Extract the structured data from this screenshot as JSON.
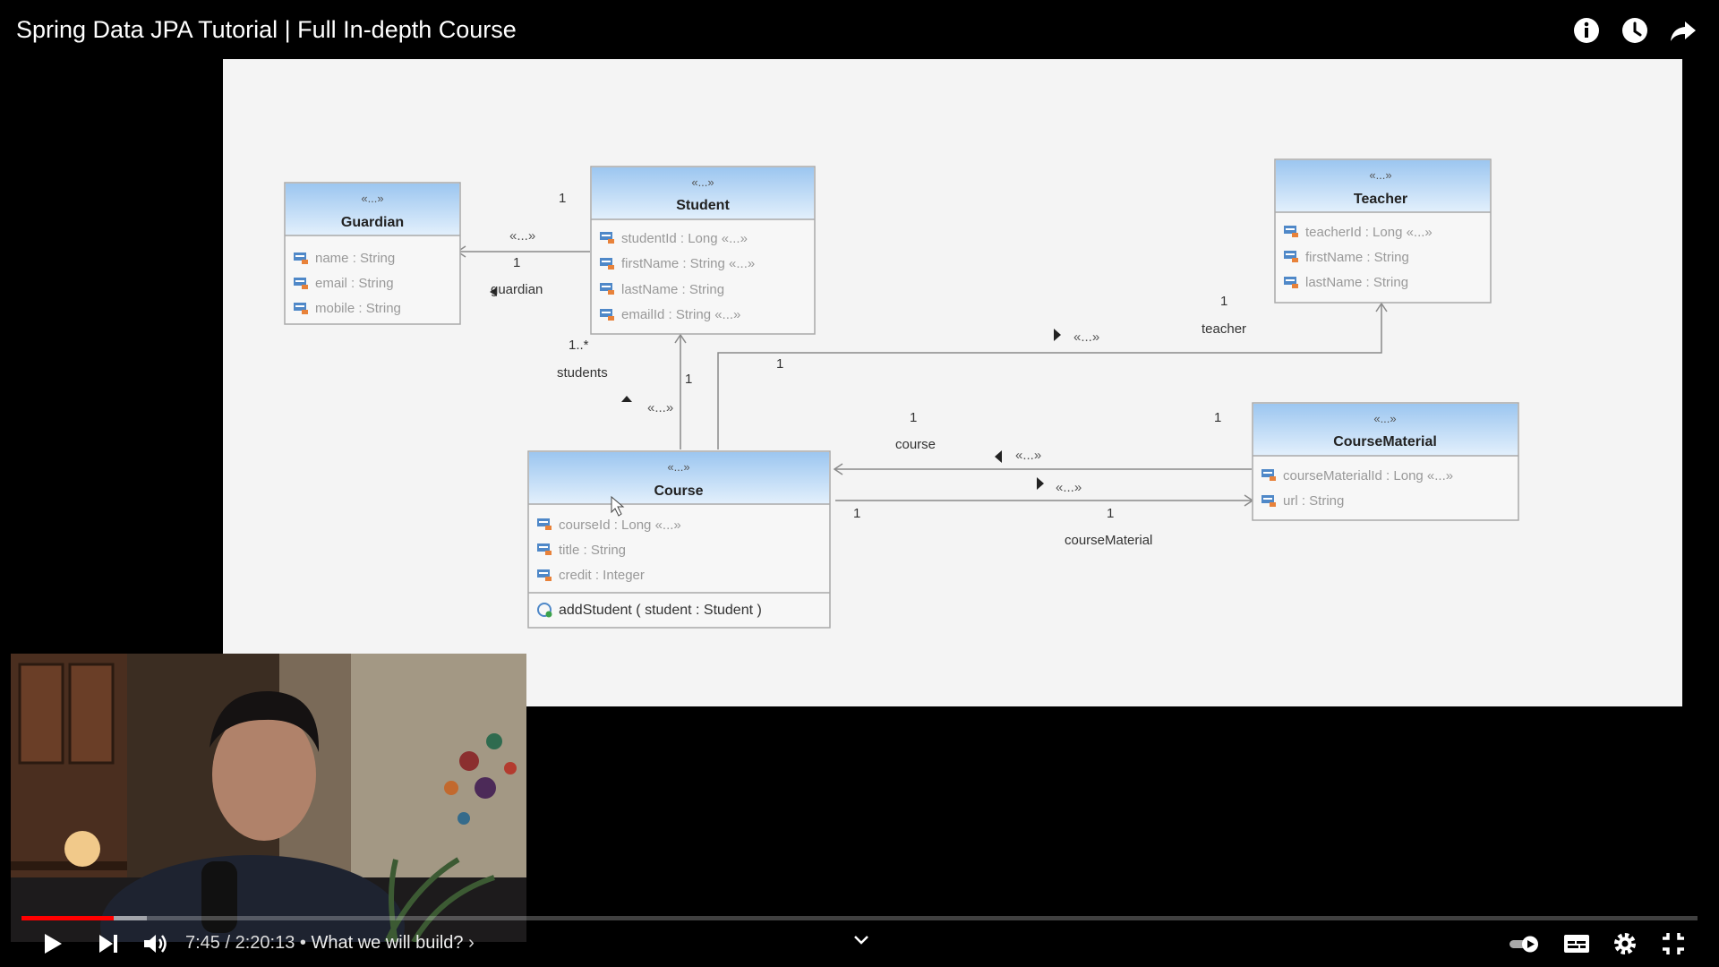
{
  "video": {
    "title": "Spring Data JPA Tutorial | Full In-depth Course",
    "current_time": "7:45",
    "duration": "2:20:13",
    "chapter": "What we will build?",
    "progress_fraction": 0.055,
    "accent_color": "#ff0000"
  },
  "top_icons": [
    "info-icon",
    "watch-later-icon",
    "share-icon"
  ],
  "controls": {
    "left": [
      "play-icon",
      "next-icon",
      "volume-icon"
    ],
    "right": [
      "autoplay-toggle-icon",
      "subtitles-icon",
      "settings-icon",
      "exit-fullscreen-icon"
    ]
  },
  "diagram": {
    "stereotype": "«...»",
    "classes": {
      "guardian": {
        "name": "Guardian",
        "attrs": [
          "name : String",
          "email : String",
          "mobile : String"
        ]
      },
      "student": {
        "name": "Student",
        "attrs": [
          "studentId : Long  «...»",
          "firstName : String  «...»",
          "lastName : String",
          "emailId : String  «...»"
        ]
      },
      "teacher": {
        "name": "Teacher",
        "attrs": [
          "teacherId : Long  «...»",
          "firstName : String",
          "lastName : String"
        ]
      },
      "course": {
        "name": "Course",
        "attrs": [
          "courseId : Long  «...»",
          "title : String",
          "credit : Integer"
        ],
        "ops": [
          "addStudent ( student : Student )"
        ]
      },
      "coursematerial": {
        "name": "CourseMaterial",
        "attrs": [
          "courseMaterialId : Long  «...»",
          "url : String"
        ]
      }
    },
    "labels": {
      "one": "1",
      "many": "1..*",
      "guardian": "guardian",
      "students": "students",
      "teacher": "teacher",
      "course": "course",
      "courseMaterial": "courseMaterial"
    }
  }
}
